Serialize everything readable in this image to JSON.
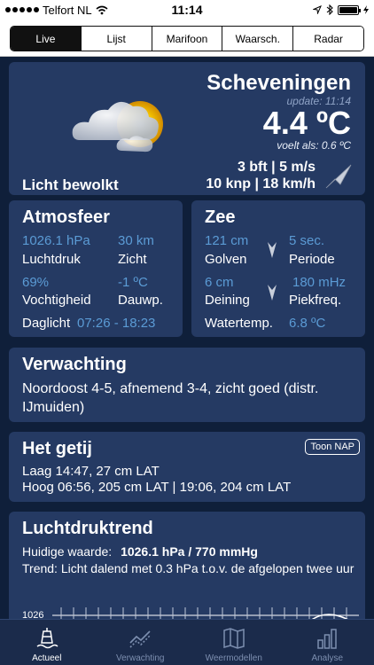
{
  "status_bar": {
    "carrier": "Telfort NL",
    "time": "11:14"
  },
  "segments": [
    {
      "label": "Live",
      "active": true
    },
    {
      "label": "Lijst",
      "active": false
    },
    {
      "label": "Marifoon",
      "active": false
    },
    {
      "label": "Waarsch.",
      "active": false
    },
    {
      "label": "Radar",
      "active": false
    }
  ],
  "main": {
    "city": "Scheveningen",
    "update": "update: 11:14",
    "temperature": "4.4 ºC",
    "feels_like": "voelt als: 0.6 ºC",
    "wind_line1": "3 bft | 5 m/s",
    "wind_line2": "10 knp | 18 km/h",
    "description": "Licht bewolkt",
    "icon": "partly-cloudy-icon"
  },
  "atmosfeer": {
    "title": "Atmosfeer",
    "pressure_value": "1026.1 hPa",
    "pressure_label": "Luchtdruk",
    "visibility_value": "30 km",
    "visibility_label": "Zicht",
    "humidity_value": "69%",
    "humidity_label": "Vochtigheid",
    "dewpoint_value": "-1 ºC",
    "dewpoint_label": "Dauwp.",
    "daylight_label": "Daglicht",
    "daylight_value": "07:26 - 18:23"
  },
  "zee": {
    "title": "Zee",
    "waves_value": "121 cm",
    "waves_label": "Golven",
    "period_value": "5 sec.",
    "period_label": "Periode",
    "swell_value": "6 cm",
    "swell_label": "Deining",
    "peakfreq_value": "180 mHz",
    "peakfreq_label": "Piekfreq.",
    "watertemp_label": "Watertemp.",
    "watertemp_value": "6.8 ºC"
  },
  "forecast": {
    "title": "Verwachting",
    "text": "Noordoost 4-5,  afnemend 3-4, zicht goed (distr. IJmuiden)"
  },
  "tide": {
    "title": "Het getij",
    "button": "Toon NAP",
    "low": "Laag 14:47, 27 cm LAT",
    "high": "Hoog 06:56, 205 cm LAT | 19:06, 204 cm LAT"
  },
  "trend": {
    "title": "Luchtdruktrend",
    "current_label": "Huidige waarde:",
    "current_value": "1026.1 hPa / 770 mmHg",
    "trend_text": "Trend: Licht dalend met 0.3 hPa t.o.v. de afgelopen twee uur",
    "axis_label": "1026"
  },
  "tabs": [
    {
      "label": "Actueel",
      "icon": "buoy-icon",
      "active": true
    },
    {
      "label": "Verwachting",
      "icon": "trend-chart-icon",
      "active": false
    },
    {
      "label": "Weermodellen",
      "icon": "map-icon",
      "active": false
    },
    {
      "label": "Analyse",
      "icon": "bar-chart-icon",
      "active": false
    }
  ],
  "colors": {
    "background": "#0f1f3a",
    "card": "#253a63",
    "accent_value": "#5b9bd5",
    "tab_bar": "#1b2b4b"
  }
}
